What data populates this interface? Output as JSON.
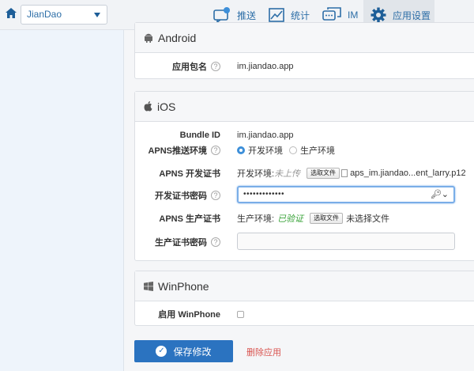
{
  "header": {
    "app_name": "JianDao",
    "nav": [
      {
        "label": "推送",
        "icon": "chat-bubble-icon"
      },
      {
        "label": "统计",
        "icon": "chart-icon"
      },
      {
        "label": "IM",
        "icon": "messages-icon"
      },
      {
        "label": "应用设置",
        "icon": "gear-icon"
      }
    ],
    "active_nav": "应用设置"
  },
  "android": {
    "title": "Android",
    "package_label": "应用包名",
    "package_value": "im.jiandao.app"
  },
  "ios": {
    "title": "iOS",
    "bundle_label": "Bundle ID",
    "bundle_value": "im.jiandao.app",
    "apns_env_label": "APNS推送环境",
    "env_dev": "开发环境",
    "env_prod": "生产环境",
    "selected_env": "开发环境",
    "dev_cert_label": "APNS 开发证书",
    "dev_env_prefix": "开发环境:",
    "dev_cert_status": "未上传",
    "choose_file": "选取文件",
    "dev_cert_file": "aps_im.jiandao...ent_larry.p12",
    "dev_pw_label": "开发证书密码",
    "dev_pw_value": "•••••••••••••",
    "prod_cert_label": "APNS 生产证书",
    "prod_env_prefix": "生产环境:",
    "prod_cert_status": "已验证",
    "prod_cert_file": "未选择文件",
    "prod_pw_label": "生产证书密码",
    "prod_pw_value": ""
  },
  "winphone": {
    "title": "WinPhone",
    "enable_label": "启用 WinPhone",
    "enabled": false
  },
  "actions": {
    "save": "保存修改",
    "delete": "删除应用"
  },
  "colors": {
    "brand_blue": "#2b73c0",
    "nav_text": "#2d6ea7",
    "verified_green": "#3aa33a",
    "danger_red": "#d9534f"
  }
}
